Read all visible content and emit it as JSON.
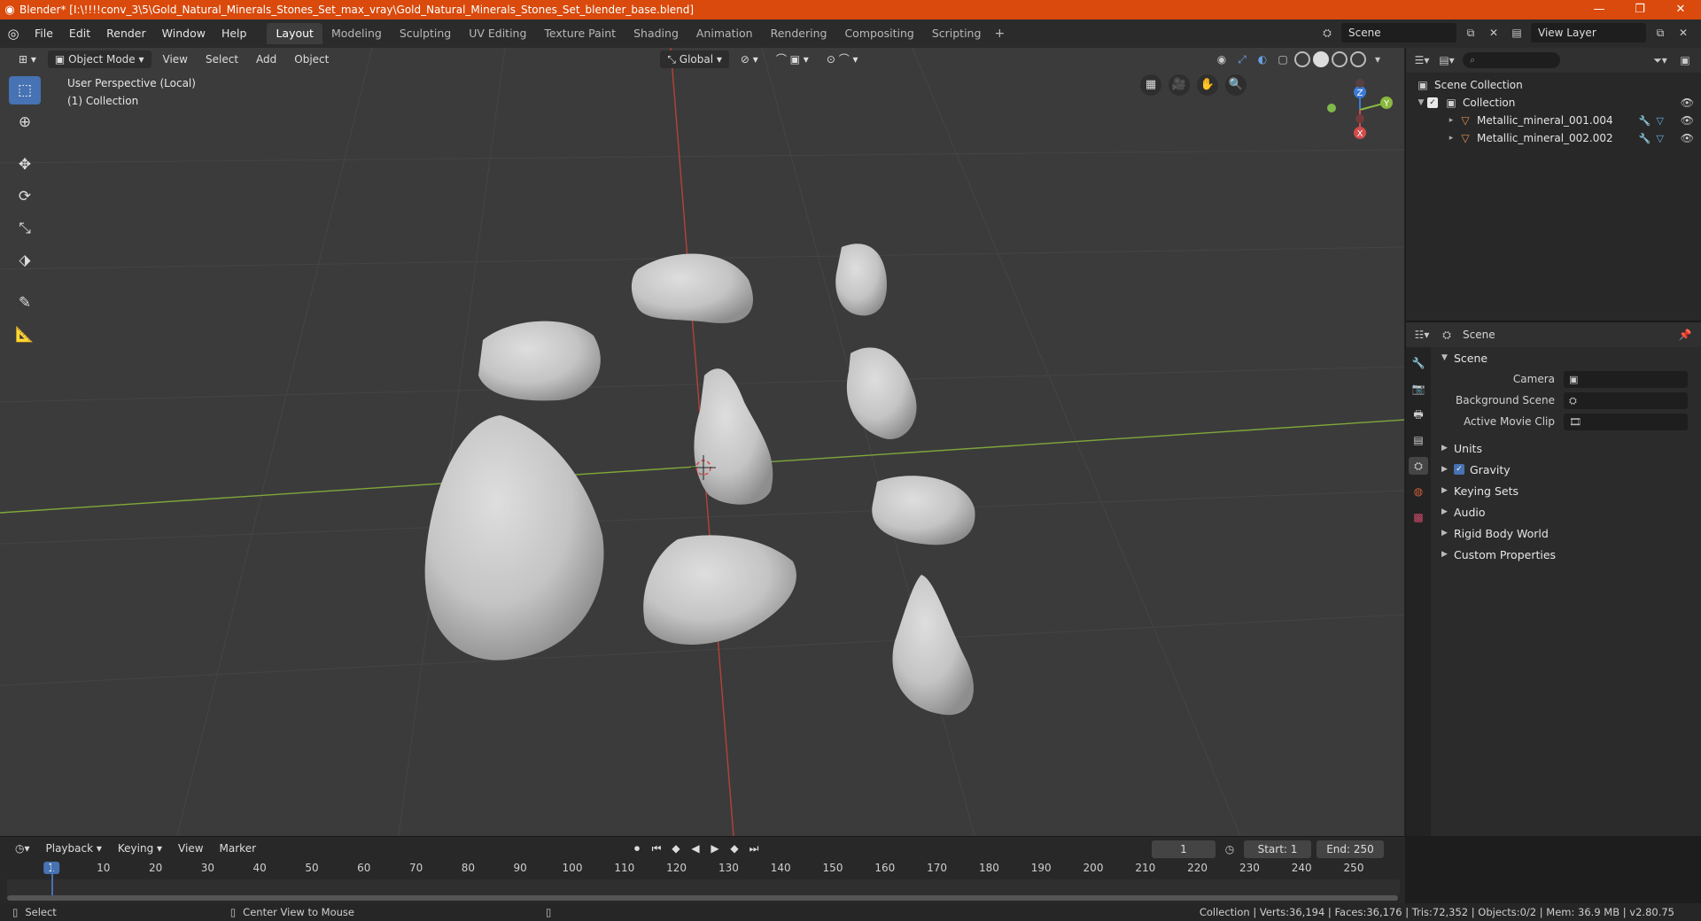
{
  "window": {
    "title": "Blender* [I:\\!!!!conv_3\\5\\Gold_Natural_Minerals_Stones_Set_max_vray\\Gold_Natural_Minerals_Stones_Set_blender_base.blend]",
    "controls": [
      "—",
      "❐",
      "✕"
    ]
  },
  "menu": [
    "File",
    "Edit",
    "Render",
    "Window",
    "Help"
  ],
  "workspaces": [
    {
      "label": "Layout",
      "active": true
    },
    {
      "label": "Modeling"
    },
    {
      "label": "Sculpting"
    },
    {
      "label": "UV Editing"
    },
    {
      "label": "Texture Paint"
    },
    {
      "label": "Shading"
    },
    {
      "label": "Animation"
    },
    {
      "label": "Rendering"
    },
    {
      "label": "Compositing"
    },
    {
      "label": "Scripting"
    }
  ],
  "scene_selector": "Scene",
  "view_layer": "View Layer",
  "viewport": {
    "mode": "Object Mode",
    "menus": [
      "View",
      "Select",
      "Add",
      "Object"
    ],
    "transform_orientation": "Global",
    "info_line1": "User Perspective (Local)",
    "info_line2": "(1) Collection",
    "gizmo_labels": {
      "z": "Z",
      "y": "Y",
      "x": "X"
    }
  },
  "outliner": {
    "root": "Scene Collection",
    "collection": "Collection",
    "items": [
      {
        "name": "Metallic_mineral_001.004"
      },
      {
        "name": "Metallic_mineral_002.002"
      }
    ]
  },
  "properties": {
    "header": "Scene",
    "section": "Scene",
    "fields": [
      {
        "label": "Camera"
      },
      {
        "label": "Background Scene"
      },
      {
        "label": "Active Movie Clip"
      }
    ],
    "subsections": [
      "Units",
      "Gravity",
      "Keying Sets",
      "Audio",
      "Rigid Body World",
      "Custom Properties"
    ]
  },
  "timeline": {
    "menus": [
      "Playback",
      "Keying",
      "View",
      "Marker"
    ],
    "current_frame": "1",
    "start_label": "Start:",
    "start": "1",
    "end_label": "End:",
    "end": "250",
    "ruler": [
      "1",
      "10",
      "20",
      "30",
      "40",
      "50",
      "60",
      "70",
      "80",
      "90",
      "100",
      "110",
      "120",
      "130",
      "140",
      "150",
      "160",
      "170",
      "180",
      "190",
      "200",
      "210",
      "220",
      "230",
      "240",
      "250"
    ]
  },
  "statusbar": {
    "left1": "Select",
    "left2": "Center View to Mouse",
    "right": "Collection | Verts:36,194 | Faces:36,176 | Tris:72,352 | Objects:0/2 | Mem: 36.9 MB | v2.80.75"
  },
  "colors": {
    "title_bar": "#d94a0c",
    "accent": "#4772b3",
    "axis_x": "#c0403a",
    "axis_y": "#7fa83a"
  }
}
